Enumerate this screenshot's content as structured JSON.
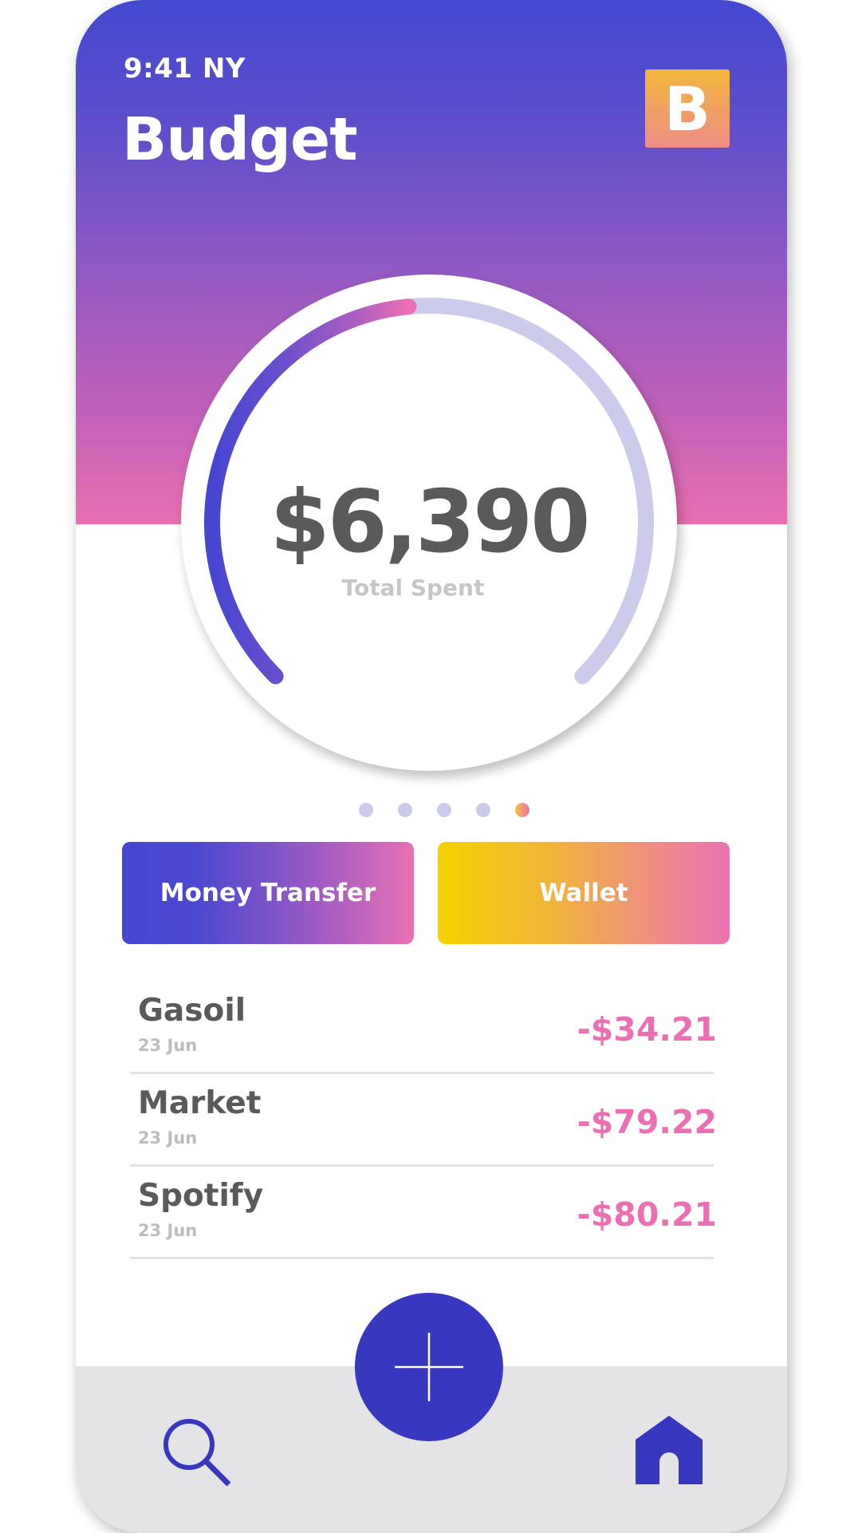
{
  "status": {
    "time": "9:41 NY"
  },
  "header": {
    "title": "Budget",
    "logo_letter": "B"
  },
  "summary": {
    "amount": "$6,390",
    "label": "Total Spent",
    "progress_fraction": 0.48
  },
  "pager": {
    "count": 5,
    "active_index": 4
  },
  "actions": {
    "transfer_label": "Money Transfer",
    "wallet_label": "Wallet"
  },
  "transactions": [
    {
      "name": "Gasoil",
      "date": "23 Jun",
      "amount": "-$34.21"
    },
    {
      "name": "Market",
      "date": "23 Jun",
      "amount": "-$79.22"
    },
    {
      "name": "Spotify",
      "date": "23 Jun",
      "amount": "-$80.21"
    }
  ],
  "nav": {
    "left_icon": "search-icon",
    "center_icon": "plus-icon",
    "right_icon": "home-icon"
  },
  "colors": {
    "primary": "#3737c0",
    "accent_pink": "#ec6fb4",
    "accent_yellow": "#f4d300",
    "track": "#cccbeb",
    "text_dark": "#5a5a5a",
    "text_muted": "#bdbdbd"
  }
}
